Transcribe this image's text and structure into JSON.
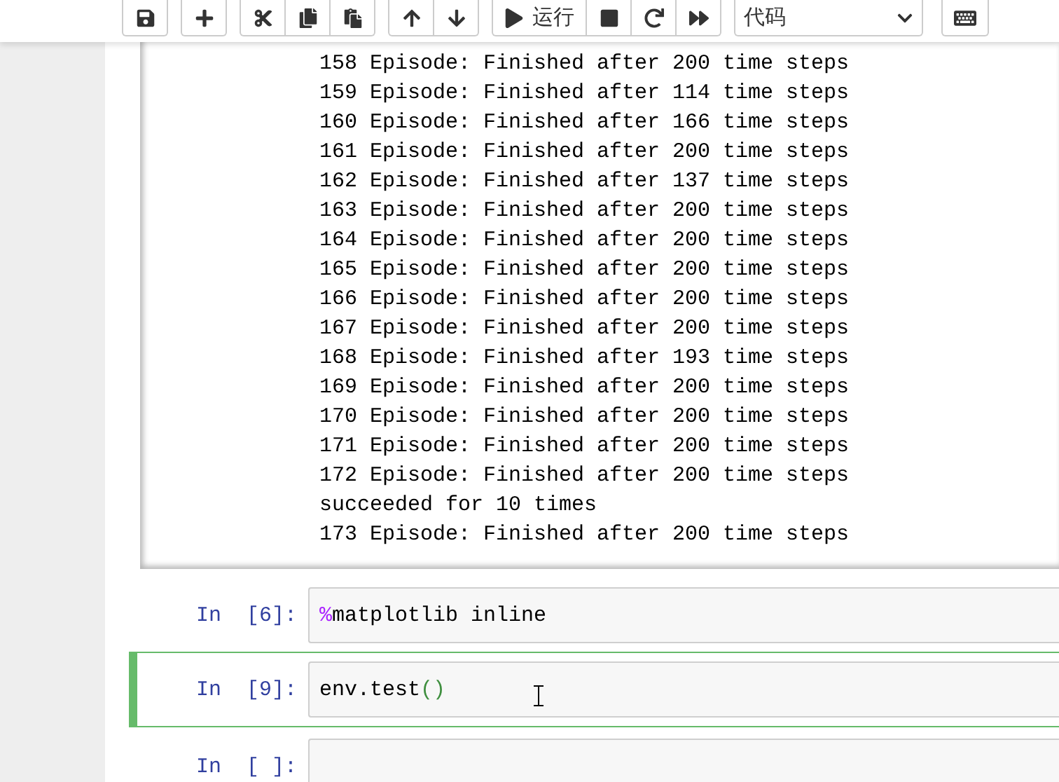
{
  "toolbar": {
    "run_label": "运行",
    "cell_type": "代码"
  },
  "output_lines": [
    "158 Episode: Finished after 200 time steps",
    "159 Episode: Finished after 114 time steps",
    "160 Episode: Finished after 166 time steps",
    "161 Episode: Finished after 200 time steps",
    "162 Episode: Finished after 137 time steps",
    "163 Episode: Finished after 200 time steps",
    "164 Episode: Finished after 200 time steps",
    "165 Episode: Finished after 200 time steps",
    "166 Episode: Finished after 200 time steps",
    "167 Episode: Finished after 200 time steps",
    "168 Episode: Finished after 193 time steps",
    "169 Episode: Finished after 200 time steps",
    "170 Episode: Finished after 200 time steps",
    "171 Episode: Finished after 200 time steps",
    "172 Episode: Finished after 200 time steps",
    "succeeded for 10 times",
    "173 Episode: Finished after 200 time steps"
  ],
  "cells": [
    {
      "prompt": "In  [6]:",
      "selected": false,
      "code": [
        {
          "kind": "magic",
          "text": "%"
        },
        {
          "kind": "plain",
          "text": "matplotlib inline"
        }
      ]
    },
    {
      "prompt": "In  [9]:",
      "selected": true,
      "code": [
        {
          "kind": "plain",
          "text": "env.test"
        },
        {
          "kind": "paren",
          "text": "()"
        }
      ]
    },
    {
      "prompt": "In  [ ]:",
      "selected": false
    }
  ]
}
